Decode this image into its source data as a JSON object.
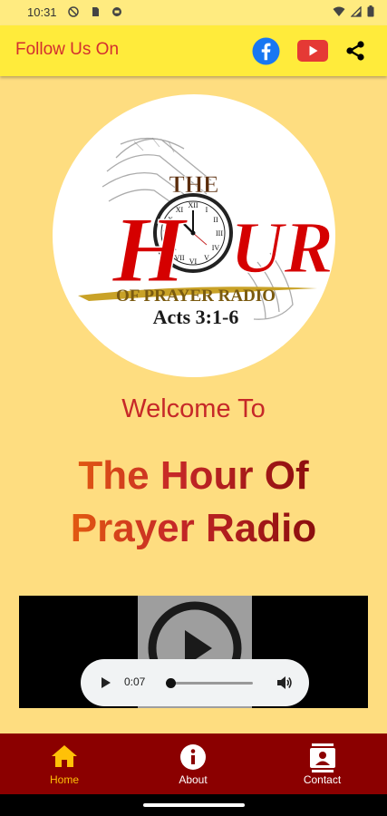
{
  "status_bar": {
    "time": "10:31"
  },
  "header": {
    "title": "Follow Us On",
    "icons": [
      "facebook-icon",
      "youtube-icon",
      "share-icon"
    ],
    "colors": {
      "background": "#FFEB3B",
      "title": "#D32F2F",
      "facebook": "#1877F2",
      "youtube": "#E53935"
    }
  },
  "logo": {
    "line1": "THE",
    "word_left": "H",
    "word_right": "UR",
    "subtitle": "OF PRAYER RADIO",
    "verse": "Acts 3:1-6"
  },
  "welcome_text": "Welcome To",
  "station": {
    "line1": "The Hour Of",
    "line2": "Prayer Radio"
  },
  "player": {
    "time": "0:07",
    "progress": 0.0
  },
  "bottom_nav": {
    "items": [
      {
        "label": "Home",
        "icon": "home-icon",
        "active": true
      },
      {
        "label": "About",
        "icon": "info-icon",
        "active": false
      },
      {
        "label": "Contact",
        "icon": "contact-icon",
        "active": false
      }
    ],
    "colors": {
      "background": "#8B0000",
      "active": "#FFC107",
      "inactive": "#FFFFFF"
    }
  }
}
